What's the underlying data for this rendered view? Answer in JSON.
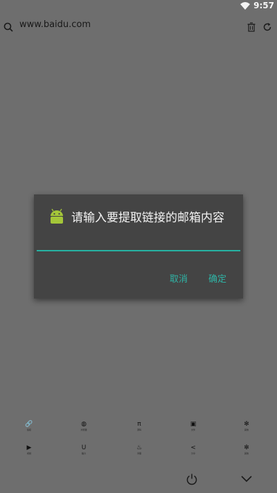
{
  "status_bar": {
    "time": "9:57",
    "icons": [
      "wifi-icon"
    ]
  },
  "url_bar": {
    "url": "www.baidu.com",
    "icons": [
      "search-icon",
      "trash-icon",
      "refresh-icon"
    ]
  },
  "dialog": {
    "title": "请输入要提取链接的邮箱内容",
    "icon": "android-icon",
    "input_value": "",
    "accent_color": "#26b3a3",
    "buttons": {
      "cancel": "取消",
      "confirm": "确定"
    }
  },
  "toolbar": {
    "row1": [
      {
        "icon": "link-icon",
        "glyph": "🔗",
        "label": "链接"
      },
      {
        "icon": "globe-icon",
        "glyph": "◍",
        "label": "浏览器"
      },
      {
        "icon": "pi-icon",
        "glyph": "π",
        "label": "源码"
      },
      {
        "icon": "document-icon",
        "glyph": "▣",
        "label": "文件"
      },
      {
        "icon": "snowflake-icon",
        "glyph": "✻",
        "label": "其他"
      }
    ],
    "row2": [
      {
        "icon": "play-icon",
        "glyph": "▶",
        "label": "视频"
      },
      {
        "icon": "magnet-icon",
        "glyph": "U",
        "label": "磁力"
      },
      {
        "icon": "clean-icon",
        "glyph": "♨",
        "label": "清理"
      },
      {
        "icon": "share-icon",
        "glyph": "<",
        "label": "分享"
      },
      {
        "icon": "snowflake-icon",
        "glyph": "✻",
        "label": "其他"
      }
    ],
    "bottom_icons": [
      "power-icon",
      "chevron-down-icon"
    ]
  }
}
